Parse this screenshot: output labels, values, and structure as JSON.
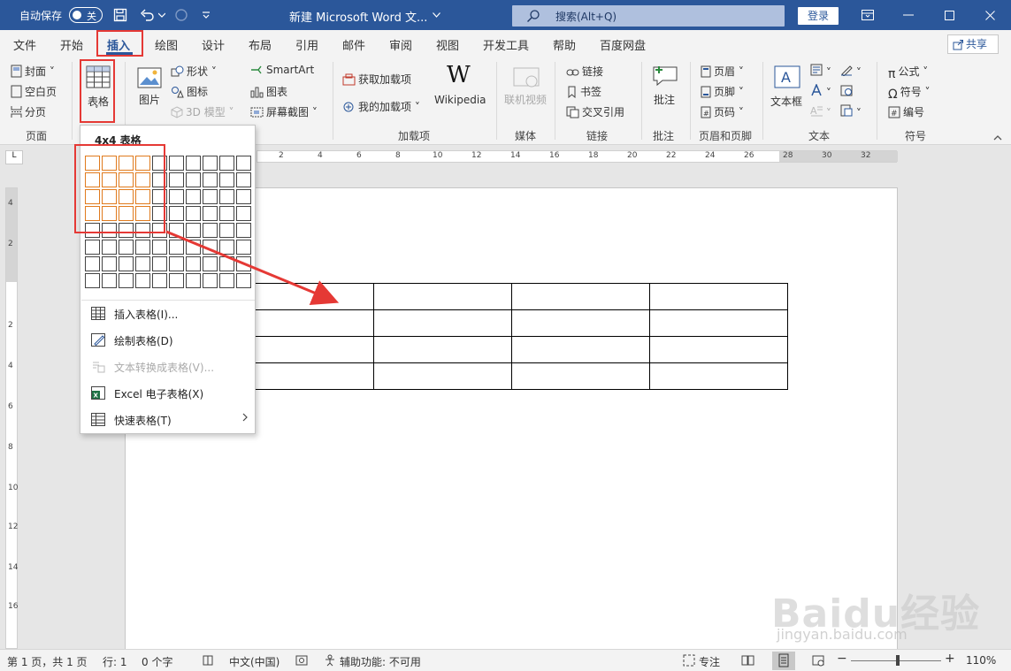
{
  "titlebar": {
    "autosave_label": "自动保存",
    "autosave_state": "关",
    "doc_title": "新建 Microsoft Word 文...",
    "search_placeholder": "搜索(Alt+Q)",
    "login_label": "登录"
  },
  "tabs": [
    "文件",
    "开始",
    "插入",
    "绘图",
    "设计",
    "布局",
    "引用",
    "邮件",
    "审阅",
    "视图",
    "开发工具",
    "帮助",
    "百度网盘"
  ],
  "active_tab": "插入",
  "share_label": "共享",
  "ribbon": {
    "pages": {
      "cover": "封面",
      "blank": "空白页",
      "break": "分页",
      "group": "页面"
    },
    "table": {
      "label": "表格"
    },
    "illustrations": {
      "picture": "图片",
      "shapes": "形状",
      "icons": "图标",
      "model3d": "3D 模型",
      "smartart": "SmartArt",
      "chart": "图表",
      "screenshot": "屏幕截图"
    },
    "addins": {
      "get": "获取加载项",
      "mine": "我的加载项",
      "wikipedia": "Wikipedia",
      "group": "加载项"
    },
    "media": {
      "video": "联机视频",
      "group": "媒体"
    },
    "links": {
      "link": "链接",
      "bookmark": "书签",
      "crossref": "交叉引用",
      "group": "链接"
    },
    "comments": {
      "comment": "批注",
      "group": "批注"
    },
    "headerfooter": {
      "header": "页眉",
      "footer": "页脚",
      "pagenum": "页码",
      "group": "页眉和页脚"
    },
    "text": {
      "textbox": "文本框",
      "group": "文本"
    },
    "symbols": {
      "equation": "公式",
      "symbol": "符号",
      "number": "编号",
      "group": "符号"
    }
  },
  "table_menu": {
    "title": "4x4 表格",
    "rows_selected": 4,
    "cols_selected": 4,
    "items": [
      {
        "label": "插入表格(I)...",
        "enabled": true
      },
      {
        "label": "绘制表格(D)",
        "enabled": true
      },
      {
        "label": "文本转换成表格(V)...",
        "enabled": false
      },
      {
        "label": "Excel 电子表格(X)",
        "enabled": true
      },
      {
        "label": "快速表格(T)",
        "enabled": true
      }
    ]
  },
  "ruler": {
    "h_ticks": [
      "2",
      "4",
      "6",
      "8",
      "10",
      "12",
      "14",
      "16",
      "18",
      "20",
      "22",
      "24",
      "26",
      "28",
      "30",
      "32"
    ],
    "v_ticks": [
      "4",
      "2",
      "2",
      "4",
      "6",
      "8",
      "10",
      "12",
      "14",
      "16",
      "18"
    ]
  },
  "statusbar": {
    "page": "第 1 页，共 1 页",
    "row": "行: 1",
    "words": "0 个字",
    "language": "中文(中国)",
    "accessibility": "辅助功能: 不可用",
    "focus": "专注",
    "zoom": "110%"
  },
  "colors": {
    "accent": "#2b579a",
    "highlight": "#e53935",
    "grid_selected": "#e07b1e"
  },
  "watermark": {
    "logo": "Baidu经验",
    "url": "jingyan.baidu.com"
  }
}
